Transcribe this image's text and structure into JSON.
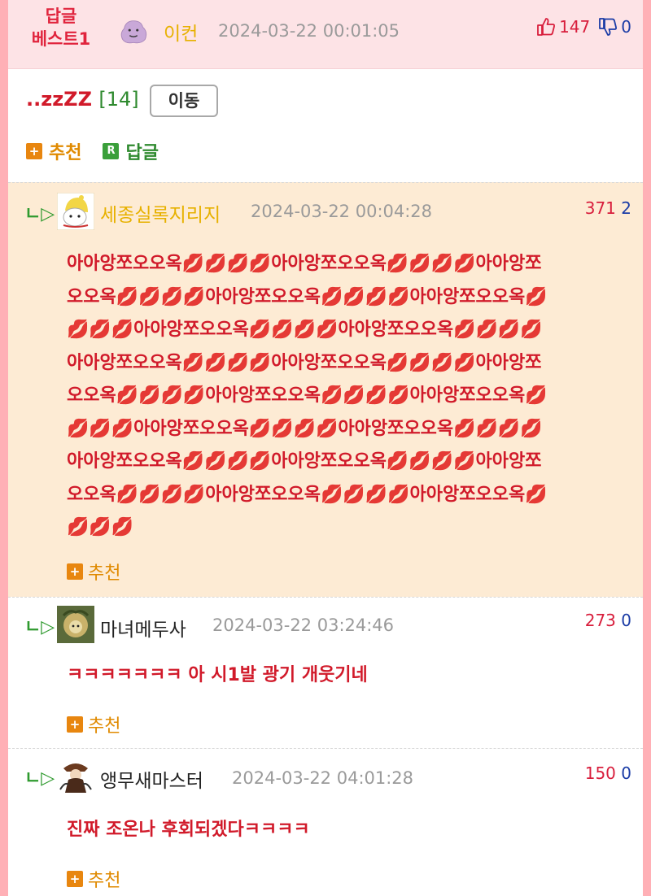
{
  "best": {
    "badge_line1": "답글",
    "badge_line2": "베스트1",
    "nick": "이컨",
    "date": "2024-03-22 00:01:05",
    "up": "147",
    "down": "0"
  },
  "post": {
    "title": "..zzZZ",
    "count": "[14]",
    "move_label": "이동",
    "recommend_label": "추천",
    "reply_label": "답글"
  },
  "replies": [
    {
      "nick": "세종실록지리지",
      "date": "2024-03-22 00:04:28",
      "up": "371",
      "down": "2",
      "lines": [
        "아아앙쪼오오옥💋💋💋💋아아앙쪼오오옥💋💋💋💋아아앙쪼",
        "오오옥💋💋💋💋아아앙쪼오오옥💋💋💋💋아아앙쪼오오옥💋",
        "💋💋💋아아앙쪼오오옥💋💋💋💋아아앙쪼오오옥💋💋💋💋",
        "아아앙쪼오오옥💋💋💋💋아아앙쪼오오옥💋💋💋💋아아앙쪼",
        "오오옥💋💋💋💋아아앙쪼오오옥💋💋💋💋아아앙쪼오오옥💋",
        "💋💋💋아아앙쪼오오옥💋💋💋💋아아앙쪼오오옥💋💋💋💋",
        "아아앙쪼오오옥💋💋💋💋아아앙쪼오오옥💋💋💋💋아아앙쪼",
        "오오옥💋💋💋💋아아앙쪼오오옥💋💋💋💋아아앙쪼오오옥💋",
        "💋💋💋"
      ],
      "recommend_label": "추천"
    },
    {
      "nick": "마녀메두사",
      "date": "2024-03-22 03:24:46",
      "up": "273",
      "down": "0",
      "lines": [
        "ㅋㅋㅋㅋㅋㅋㅋ 아 시1발 광기 개웃기네"
      ],
      "recommend_label": "추천"
    },
    {
      "nick": "앵무새마스터",
      "date": "2024-03-22 04:01:28",
      "up": "150",
      "down": "0",
      "lines": [
        "진짜 조온나 후회되겠다ㅋㅋㅋㅋ"
      ],
      "recommend_label": "추천"
    }
  ],
  "colors": {
    "accent_red": "#d11a2a",
    "nick_gold": "#e7b100",
    "green": "#2f8a2f",
    "orange": "#e08a00"
  }
}
